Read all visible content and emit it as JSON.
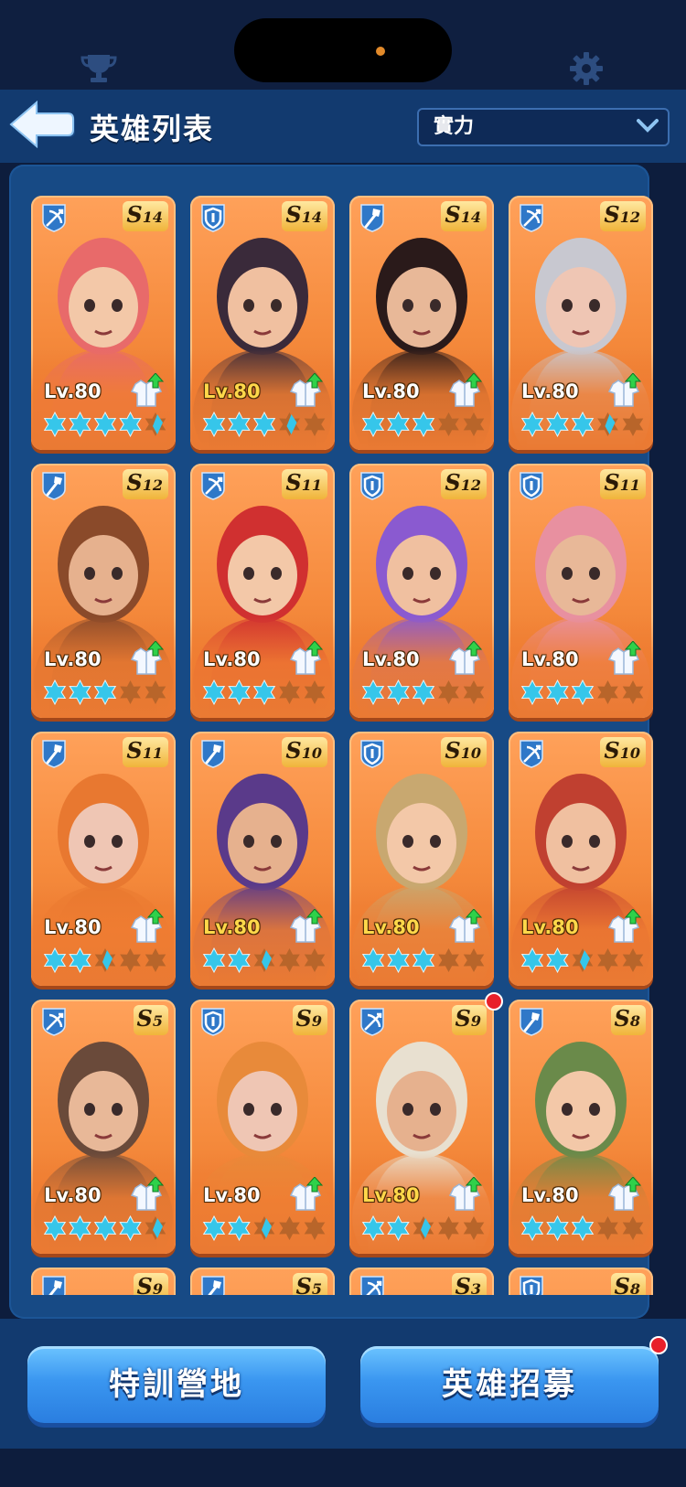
{
  "header": {
    "title": "英雄列表",
    "sort_value": "實力"
  },
  "colors": {
    "card_orange": "#f58a3c",
    "panel_blue": "#174a85",
    "button_blue": "#3a96f0",
    "star_blue": "#36c6ea",
    "star_empty": "#b8652a",
    "level_gold": "#ffd84a",
    "notification_red": "#e8202a"
  },
  "heroes": [
    {
      "role": "crossbow-icon",
      "rank": "S",
      "rank_num": "14",
      "level": "Lv.80",
      "stars": 4.5,
      "gold_level": false
    },
    {
      "role": "shield-icon",
      "rank": "S",
      "rank_num": "14",
      "level": "Lv.80",
      "stars": 3.5,
      "gold_level": true
    },
    {
      "role": "staff-icon",
      "rank": "S",
      "rank_num": "14",
      "level": "Lv.80",
      "stars": 3,
      "gold_level": false
    },
    {
      "role": "crossbow-icon",
      "rank": "S",
      "rank_num": "12",
      "level": "Lv.80",
      "stars": 3.5,
      "gold_level": false
    },
    {
      "role": "staff-icon",
      "rank": "S",
      "rank_num": "12",
      "level": "Lv.80",
      "stars": 3,
      "gold_level": false
    },
    {
      "role": "crossbow-icon",
      "rank": "S",
      "rank_num": "11",
      "level": "Lv.80",
      "stars": 3,
      "gold_level": false
    },
    {
      "role": "shield-icon",
      "rank": "S",
      "rank_num": "12",
      "level": "Lv.80",
      "stars": 3,
      "gold_level": false
    },
    {
      "role": "shield-icon",
      "rank": "S",
      "rank_num": "11",
      "level": "Lv.80",
      "stars": 3,
      "gold_level": false
    },
    {
      "role": "staff-icon",
      "rank": "S",
      "rank_num": "11",
      "level": "Lv.80",
      "stars": 2.5,
      "gold_level": false
    },
    {
      "role": "staff-icon",
      "rank": "S",
      "rank_num": "10",
      "level": "Lv.80",
      "stars": 2.5,
      "gold_level": true
    },
    {
      "role": "shield-icon",
      "rank": "S",
      "rank_num": "10",
      "level": "Lv.80",
      "stars": 3,
      "gold_level": true
    },
    {
      "role": "crossbow-icon",
      "rank": "S",
      "rank_num": "10",
      "level": "Lv.80",
      "stars": 2.5,
      "gold_level": true
    },
    {
      "role": "crossbow-icon",
      "rank": "S",
      "rank_num": "5",
      "level": "Lv.80",
      "stars": 4.5,
      "gold_level": false
    },
    {
      "role": "shield-icon",
      "rank": "S",
      "rank_num": "9",
      "level": "Lv.80",
      "stars": 2.5,
      "gold_level": false
    },
    {
      "role": "crossbow-icon",
      "rank": "S",
      "rank_num": "9",
      "level": "Lv.80",
      "stars": 2.5,
      "gold_level": true,
      "notify": true
    },
    {
      "role": "staff-icon",
      "rank": "S",
      "rank_num": "8",
      "level": "Lv.80",
      "stars": 3,
      "gold_level": false
    },
    {
      "role": "staff-icon",
      "rank": "S",
      "rank_num": "9",
      "level": "",
      "stars": 0,
      "gold_level": false
    },
    {
      "role": "staff-icon",
      "rank": "S",
      "rank_num": "5",
      "level": "",
      "stars": 0,
      "gold_level": false
    },
    {
      "role": "crossbow-icon",
      "rank": "S",
      "rank_num": "3",
      "level": "",
      "stars": 0,
      "gold_level": false
    },
    {
      "role": "shield-icon",
      "rank": "S",
      "rank_num": "8",
      "level": "",
      "stars": 0,
      "gold_level": false
    }
  ],
  "buttons": {
    "training": "特訓營地",
    "recruit": "英雄招募"
  }
}
